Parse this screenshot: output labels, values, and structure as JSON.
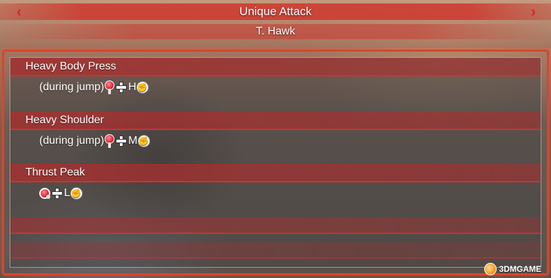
{
  "header": {
    "title": "Unique Attack",
    "subtitle": "T. Hawk",
    "prev_arrow": "‹",
    "next_arrow": "›"
  },
  "moves": [
    {
      "name": "Heavy Body Press",
      "prefix": "(during jump)",
      "button_letter": "H"
    },
    {
      "name": "Heavy Shoulder",
      "prefix": "(during jump)",
      "button_letter": "M"
    },
    {
      "name": "Thrust Peak",
      "prefix": "",
      "button_letter": "L"
    }
  ],
  "icons": {
    "stick": "joystick-icon",
    "plus": "plus-icon",
    "punch": "punch-icon"
  },
  "watermark": {
    "text": "3DMGAME"
  },
  "colors": {
    "accent_red": "#d8262a",
    "bar_red": "#af2d2d",
    "panel_border": "#d9452e"
  }
}
